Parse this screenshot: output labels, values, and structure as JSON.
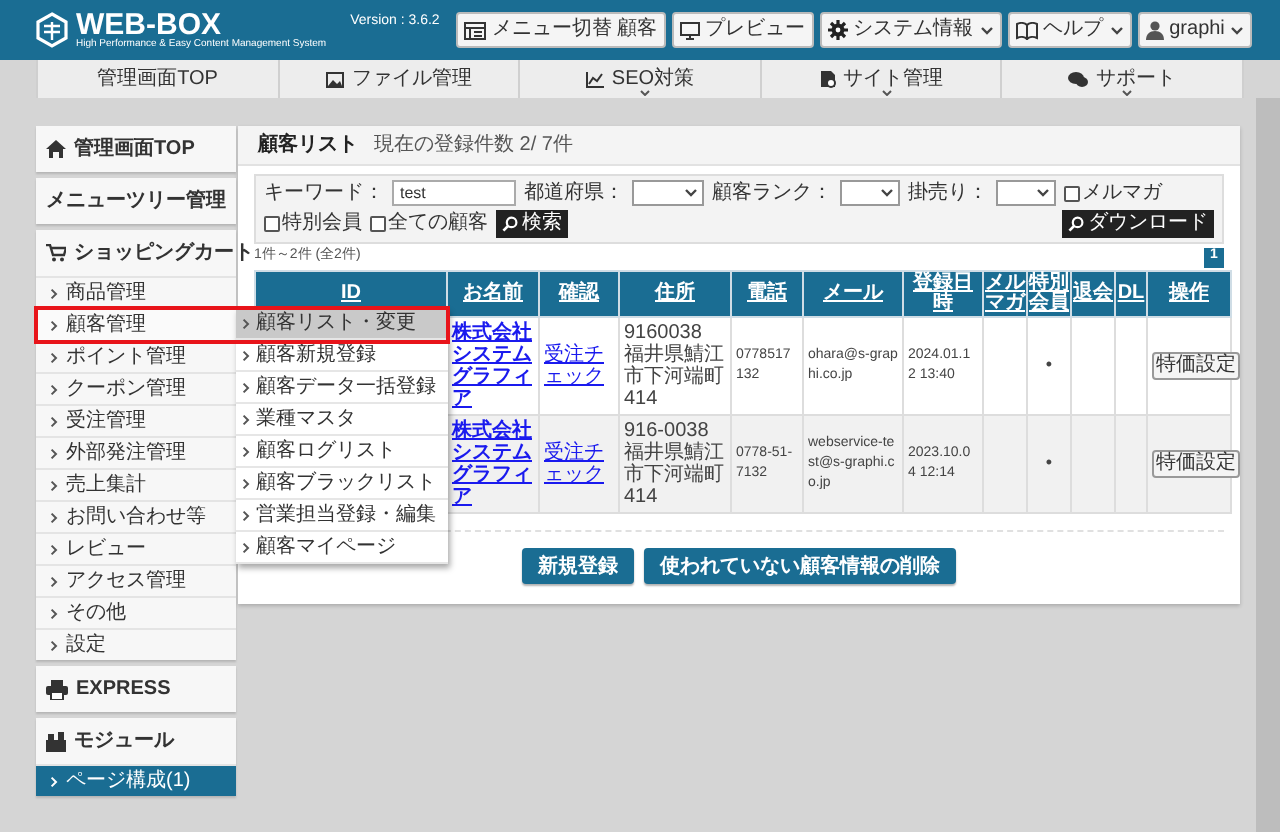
{
  "header": {
    "logo": "WEB-BOX",
    "tagline": "High Performance & Easy Content Management System",
    "version": "Version : 3.6.2",
    "buttons": [
      {
        "kind": "menu",
        "label": "メニュー切替 顧客"
      },
      {
        "kind": "preview",
        "label": "プレビュー"
      },
      {
        "kind": "system",
        "label": "システム情報"
      },
      {
        "kind": "help",
        "label": "ヘルプ"
      },
      {
        "kind": "user",
        "label": "graphi"
      }
    ]
  },
  "nav": [
    {
      "label": "管理画面TOP",
      "dropdown": false
    },
    {
      "label": "ファイル管理",
      "dropdown": false
    },
    {
      "label": "SEO対策",
      "dropdown": true
    },
    {
      "label": "サイト管理",
      "dropdown": true
    },
    {
      "label": "サポート",
      "dropdown": true
    }
  ],
  "sidebar": [
    {
      "kind": "home",
      "label": "管理画面TOP"
    },
    {
      "kind": "plain",
      "label": "メニューツリー管理"
    },
    {
      "kind": "cart",
      "label": "ショッピングカート",
      "items": [
        {
          "label": "商品管理",
          "expanded": false
        },
        {
          "label": "顧客管理",
          "expanded": true,
          "submenu": [
            {
              "label": "顧客リスト・変更",
              "selected": true
            },
            {
              "label": "顧客新規登録",
              "selected": false
            },
            {
              "label": "顧客データ一括登録",
              "selected": false
            },
            {
              "label": "業種マスタ",
              "selected": false
            },
            {
              "label": "顧客ログリスト",
              "selected": false
            },
            {
              "label": "顧客ブラックリスト",
              "selected": false
            },
            {
              "label": "営業担当登録・編集",
              "selected": false
            },
            {
              "label": "顧客マイページ",
              "selected": false
            }
          ]
        },
        {
          "label": "ポイント管理",
          "expanded": false
        },
        {
          "label": "クーポン管理",
          "expanded": false
        },
        {
          "label": "受注管理",
          "expanded": false
        },
        {
          "label": "外部発注管理",
          "expanded": false
        },
        {
          "label": "売上集計",
          "expanded": false
        },
        {
          "label": "お問い合わせ等",
          "expanded": false
        },
        {
          "label": "レビュー",
          "expanded": false
        },
        {
          "label": "アクセス管理",
          "expanded": false
        },
        {
          "label": "その他",
          "expanded": false
        },
        {
          "label": "設定",
          "expanded": false
        }
      ]
    },
    {
      "kind": "print",
      "label": "EXPRESS"
    },
    {
      "kind": "module",
      "label": "モジュール",
      "items": [
        {
          "label": "ページ構成(1)",
          "selected": true
        }
      ]
    }
  ],
  "panel": {
    "title": "顧客リスト",
    "count": "現在の登録件数 2/ 7件",
    "filters": {
      "keyword_label": "キーワード：",
      "keyword_value": "test",
      "prefecture_label": "都道府県：",
      "rank_label": "顧客ランク：",
      "credit_label": "掛売り：",
      "checkboxes": [
        {
          "label": "メルマガ",
          "checked": false
        },
        {
          "label": "特別会員",
          "checked": false
        },
        {
          "label": "全ての顧客",
          "checked": false
        }
      ],
      "search_button": "検索",
      "download_button": "ダウンロード"
    },
    "summary": "1件～2件 (全2件)",
    "pages": [
      {
        "label": "1",
        "selected": true
      }
    ],
    "columns": [
      "ID",
      "お名前",
      "確認",
      "住所",
      "電話",
      "メール",
      "登録日時",
      "メルマガ",
      "特別会員",
      "退会",
      "DL",
      "操作"
    ],
    "rows": [
      {
        "name": "株式会社システムグラフィア",
        "check": "受注チェック",
        "address": "9160038 福井県鯖江市下河端町414",
        "phone": "0778517132",
        "email": "ohara@s-graphi.co.jp",
        "date": "2024.01.12 13:40",
        "special": "•",
        "action": "特価設定"
      },
      {
        "name": "株式会社システムグラフィア",
        "check": "受注チェック",
        "address": "916-0038 福井県鯖江市下河端町414",
        "phone": "0778-51-7132",
        "email": "webservice-test@s-graphi.co.jp",
        "date": "2023.10.04 12:14",
        "special": "•",
        "action": "特価設定"
      }
    ],
    "buttons": [
      "新規登録",
      "使われていない顧客情報の削除"
    ]
  }
}
